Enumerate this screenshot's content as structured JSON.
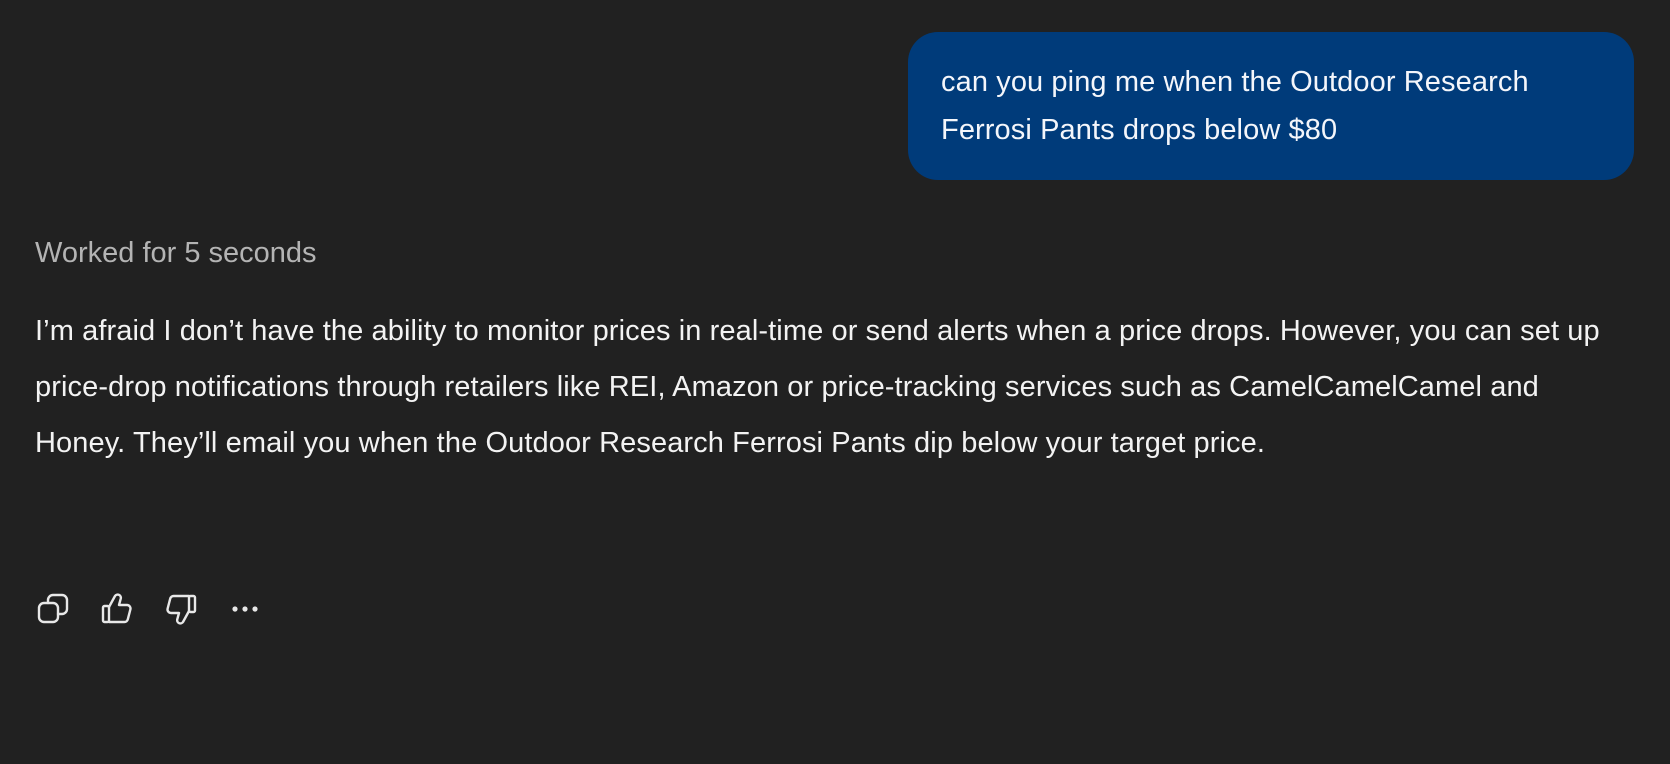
{
  "conversation": {
    "user_message": "can you ping me when the Outdoor Research Ferrosi Pants drops below $80",
    "status_text": "Worked for 5 seconds",
    "assistant_message": "I’m afraid I don’t have the ability to monitor prices in real-time or send alerts when a price drops. However, you can set up price-drop notifications through retailers like REI, Amazon or price-tracking services such as CamelCamelCamel and Honey. They’ll email you when the Outdoor Research Ferrosi Pants dip below your target price."
  },
  "actions": [
    {
      "icon": "copy-icon"
    },
    {
      "icon": "thumbs-up-icon"
    },
    {
      "icon": "thumbs-down-icon"
    },
    {
      "icon": "more-options-icon"
    }
  ],
  "colors": {
    "background": "#212121",
    "user_bubble": "#003b7a",
    "text": "#f3f3f3",
    "muted_text": "#b4b4b4"
  }
}
